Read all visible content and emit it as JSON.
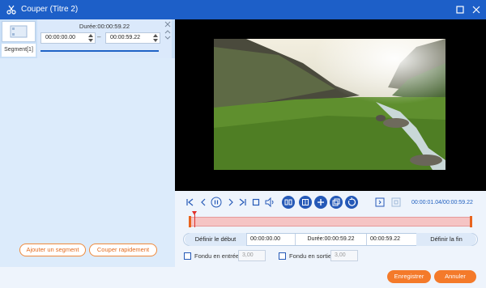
{
  "window": {
    "title": "Couper (Titre 2)"
  },
  "segments": {
    "tab_label": "Segment[1]",
    "duration_label": "Durée:00:00:59.22",
    "start_value": "00:00:00.00",
    "end_value": "00:00:59.22",
    "separator": "–"
  },
  "left_buttons": {
    "add_segment": "Ajouter un segment",
    "fast_cut": "Couper rapidement"
  },
  "player": {
    "time_readout": "00:00:01.04/00:00:59.22"
  },
  "range": {
    "set_start": "Définir le début",
    "start_value": "00:00:00.00",
    "duration": "Durée:00:00:59.22",
    "end_value": "00:00:59.22",
    "set_end": "Définir la fin"
  },
  "fade": {
    "fade_in_label": "Fondu en entrée",
    "fade_in_value": "3,00",
    "fade_out_label": "Fondu en sortie",
    "fade_out_value": "3,00"
  },
  "footer": {
    "save": "Enregistrer",
    "cancel": "Annuler"
  },
  "colors": {
    "accent": "#1d5fc8",
    "orange": "#f47a2a",
    "timeline": "#f5c4c4"
  }
}
